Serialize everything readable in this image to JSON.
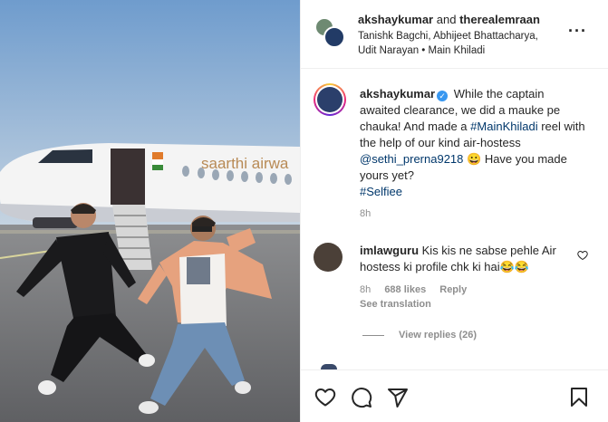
{
  "header": {
    "user1": "akshaykumar",
    "and_text": "and",
    "user2": "therealemraan",
    "subtitle": "Tanishk Bagchi, Abhijeet Bhattacharya, Udit Narayan • Main Khiladi"
  },
  "caption": {
    "username": "akshaykumar",
    "text1": "While the captain awaited clearance, we did a mauke pe chauka! And made a ",
    "hashtag1": "#MainKhiladi",
    "text2": " reel with the help of our kind air-hostess ",
    "mention": "@sethi_prerna9218",
    "emoji": "😀",
    "text3": " Have you made yours yet?",
    "hashtag2": "#Selfiee",
    "time": "8h"
  },
  "comment": {
    "username": "imlawguru",
    "text": "Kis kis ne sabse pehle Air hostess ki profile chk ki hai",
    "emojis": "😂😂",
    "time": "8h",
    "likes": "688 likes",
    "reply": "Reply",
    "see_translation": "See translation",
    "view_replies": "View replies (26)"
  },
  "media": {
    "plane_text": "saarthi airwa"
  },
  "icons": {
    "more": "more-options-icon",
    "like": "heart-icon",
    "comment": "comment-icon",
    "share": "share-icon",
    "save": "bookmark-icon"
  },
  "colors": {
    "link": "#00376b",
    "secondary": "#8e8e8e",
    "verified": "#3897f0",
    "border": "#efefef"
  }
}
